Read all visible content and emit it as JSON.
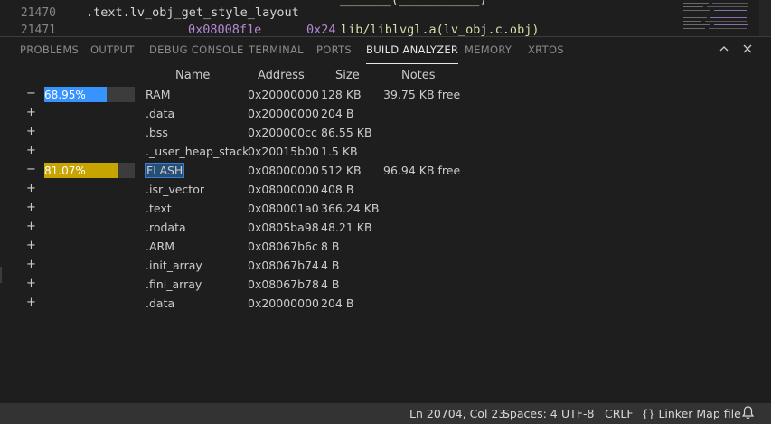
{
  "editor": {
    "lines": [
      {
        "number": "21470",
        "code": ".text.lv_obj_get_style_layout"
      },
      {
        "number": "21471",
        "code": ""
      }
    ],
    "next_line_address": "0x08008f1e",
    "next_line_size": "0x24",
    "next_line_object": "lib/liblvgl.a(lv_obj.c.obj)"
  },
  "panel": {
    "tabs": [
      {
        "label": "PROBLEMS",
        "active": false
      },
      {
        "label": "OUTPUT",
        "active": false
      },
      {
        "label": "DEBUG CONSOLE",
        "active": false
      },
      {
        "label": "TERMINAL",
        "active": false
      },
      {
        "label": "PORTS",
        "active": false
      },
      {
        "label": "BUILD ANALYZER",
        "active": true
      },
      {
        "label": "MEMORY",
        "active": false
      },
      {
        "label": "XRTOS",
        "active": false
      }
    ],
    "actions": {
      "maximize_icon": "chevron-up-icon",
      "close_icon": "close-icon"
    }
  },
  "table": {
    "headers": {
      "name": "Name",
      "address": "Address",
      "size": "Size",
      "notes": "Notes"
    },
    "rows": [
      {
        "toggle": "−",
        "usage": "68.95%",
        "usage_fraction": 0.6895,
        "bar_color": "#3794ff",
        "name": "RAM",
        "address": "0x20000000",
        "size": "128 KB",
        "notes": "39.75 KB free",
        "selected": false
      },
      {
        "toggle": "+",
        "name": ".data",
        "address": "0x20000000",
        "size": "204 B",
        "notes": ""
      },
      {
        "toggle": "+",
        "name": ".bss",
        "address": "0x200000cc",
        "size": "86.55 KB",
        "notes": ""
      },
      {
        "toggle": "+",
        "name": "._user_heap_stack",
        "address": "0x20015b00",
        "size": "1.5 KB",
        "notes": ""
      },
      {
        "toggle": "−",
        "usage": "81.07%",
        "usage_fraction": 0.8107,
        "bar_color": "#c8a400",
        "name": "FLASH",
        "address": "0x08000000",
        "size": "512 KB",
        "notes": "96.94 KB free",
        "selected": true
      },
      {
        "toggle": "+",
        "name": ".isr_vector",
        "address": "0x08000000",
        "size": "408 B",
        "notes": ""
      },
      {
        "toggle": "+",
        "name": ".text",
        "address": "0x080001a0",
        "size": "366.24 KB",
        "notes": ""
      },
      {
        "toggle": "+",
        "name": ".rodata",
        "address": "0x0805ba98",
        "size": "48.21 KB",
        "notes": ""
      },
      {
        "toggle": "+",
        "name": ".ARM",
        "address": "0x08067b6c",
        "size": "8 B",
        "notes": ""
      },
      {
        "toggle": "+",
        "name": ".init_array",
        "address": "0x08067b74",
        "size": "4 B",
        "notes": ""
      },
      {
        "toggle": "+",
        "name": ".fini_array",
        "address": "0x08067b78",
        "size": "4 B",
        "notes": ""
      },
      {
        "toggle": "+",
        "name": ".data",
        "address": "0x20000000",
        "size": "204 B",
        "notes": ""
      }
    ]
  },
  "statusbar": {
    "position": "Ln 20704, Col 23",
    "spaces": "Spaces: 4",
    "encoding": "UTF-8",
    "eol": "CRLF",
    "language_icon": "braces-icon",
    "language": "Linker Map file",
    "notifications_icon": "bell-icon"
  },
  "colors": {
    "background": "#1e1e1e",
    "statusbar": "#333333",
    "ram_bar": "#3794ff",
    "flash_bar": "#c8a400"
  }
}
